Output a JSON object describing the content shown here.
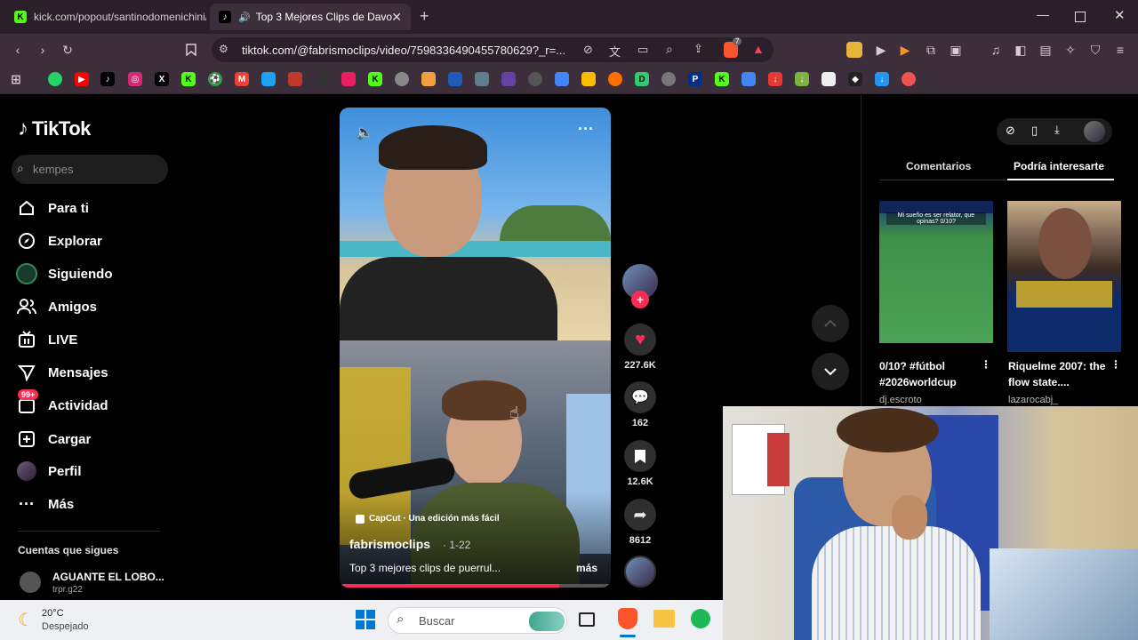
{
  "browser": {
    "tabs": [
      {
        "title": "kick.com/popout/santinodomenichini/"
      },
      {
        "title": "Top 3 Mejores Clips de Davo"
      }
    ],
    "new_tab": "+",
    "url": "tiktok.com/@fabrismoclips/video/7598336490455780629?_r=...",
    "badge_count": "7"
  },
  "sidebar": {
    "logo": "TikTok",
    "search_placeholder": "kempes",
    "items": [
      {
        "label": "Para ti",
        "icon": "home-icon"
      },
      {
        "label": "Explorar",
        "icon": "compass-icon"
      },
      {
        "label": "Siguiendo",
        "icon": "following-avatar-icon"
      },
      {
        "label": "Amigos",
        "icon": "friends-icon"
      },
      {
        "label": "LIVE",
        "icon": "live-tv-icon"
      },
      {
        "label": "Mensajes",
        "icon": "send-icon"
      },
      {
        "label": "Actividad",
        "icon": "inbox-icon",
        "badge": "99+"
      },
      {
        "label": "Cargar",
        "icon": "plus-square-icon"
      },
      {
        "label": "Perfil",
        "icon": "profile-avatar-icon"
      },
      {
        "label": "Más",
        "icon": "ellipsis-icon"
      }
    ],
    "following_heading": "Cuentas que sigues",
    "following": [
      {
        "name": "AGUANTE EL LOBO...",
        "handle": "trpr.g22"
      }
    ]
  },
  "video": {
    "effect": "CapCut · Una edición más fácil",
    "author": "fabrismoclips",
    "date": "· 1-22",
    "caption": "Top 3 mejores clips de puerrul...",
    "more": "más",
    "progress": 0.81
  },
  "actions": {
    "likes": "227.6K",
    "comments": "162",
    "saves": "12.6K",
    "shares": "8612"
  },
  "right_panel": {
    "tabs": [
      "Comentarios",
      "Podría interesarte"
    ],
    "active_tab": "Podría interesarte",
    "cards": [
      {
        "title": "0/10? #fútbol #2026worldcup",
        "author": "dj.escroto",
        "overlay": "Mi sueño es ser relator, que opinas? 0/10?"
      },
      {
        "title": "Riquelme 2007: the flow state....",
        "author": "lazarocabj_"
      }
    ]
  },
  "taskbar": {
    "weather_temp": "20°C",
    "weather_desc": "Despejado",
    "search": "Buscar"
  },
  "colors": {
    "tiktok_red": "#fe2c55",
    "tab_bar": "#2b1f2b",
    "toolbar": "#3d2e3c"
  }
}
